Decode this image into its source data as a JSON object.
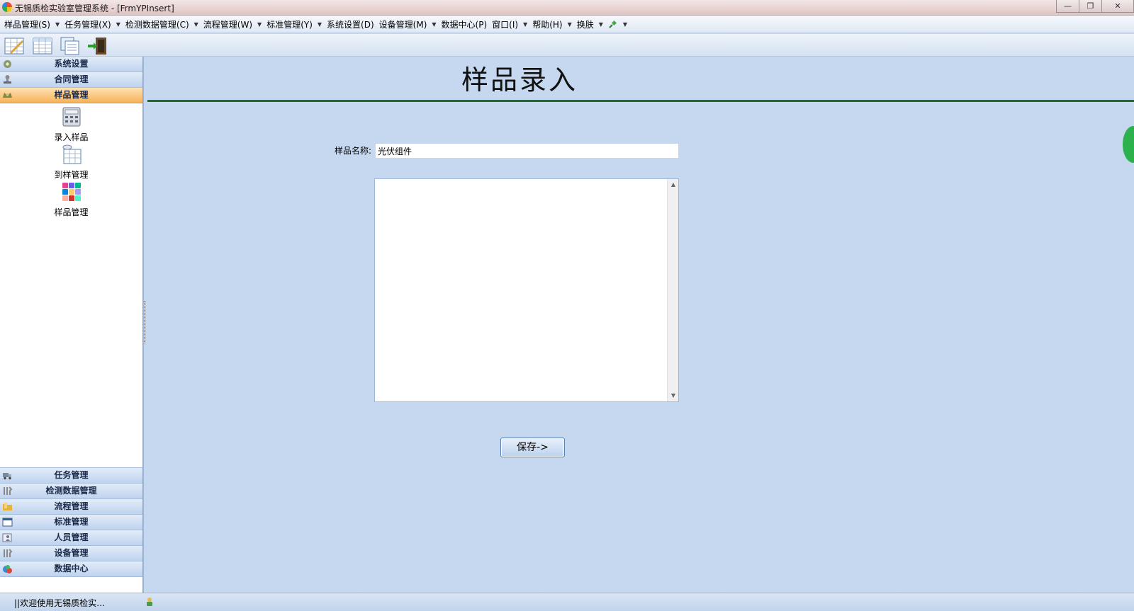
{
  "window": {
    "title": "无锡质检实验室管理系统 - [FrmYPInsert]",
    "buttons": {
      "minimize": "—",
      "restore": "❐",
      "close": "✕"
    }
  },
  "menu": [
    {
      "label": "样品管理(S)"
    },
    {
      "label": "任务管理(X)"
    },
    {
      "label": "检测数据管理(C)"
    },
    {
      "label": "流程管理(W)"
    },
    {
      "label": "标准管理(Y)"
    },
    {
      "label": "系统设置(D)"
    },
    {
      "label": "设备管理(M)"
    },
    {
      "label": "数据中心(P)"
    },
    {
      "label": "窗口(I)"
    },
    {
      "label": "帮助(H)"
    },
    {
      "label": "换肤"
    }
  ],
  "toolbar": [
    "edit-grid-icon",
    "table-icon",
    "copy-pages-icon",
    "exit-door-icon"
  ],
  "sidebar": {
    "top_groups": [
      {
        "label": "系统设置",
        "icon": "settings-icon"
      },
      {
        "label": "合同管理",
        "icon": "stamp-icon"
      },
      {
        "label": "样品管理",
        "icon": "sample-icon",
        "active": true
      }
    ],
    "sub_items": [
      {
        "label": "录入样品",
        "icon": "calculator-icon"
      },
      {
        "label": "到样管理",
        "icon": "database-table-icon"
      },
      {
        "label": "样品管理",
        "icon": "color-grid-icon"
      }
    ],
    "bottom_groups": [
      {
        "label": "任务管理",
        "icon": "truck-icon"
      },
      {
        "label": "检测数据管理",
        "icon": "tools-icon"
      },
      {
        "label": "流程管理",
        "icon": "folder-icon"
      },
      {
        "label": "标准管理",
        "icon": "window-icon"
      },
      {
        "label": "人员管理",
        "icon": "person-card-icon"
      },
      {
        "label": "设备管理",
        "icon": "wrench-icon"
      },
      {
        "label": "数据中心",
        "icon": "globe-icon"
      }
    ]
  },
  "main": {
    "title": "样品录入",
    "name_label": "样品名称:",
    "name_value": "光伏组件",
    "description_value": "",
    "save_label": "保存->"
  },
  "status": {
    "text": "||欢迎使用无锡质检实…"
  },
  "colors": {
    "accent_active": "#f6b25a",
    "rule": "#1f6b2a",
    "background": "#c6d8f0"
  }
}
